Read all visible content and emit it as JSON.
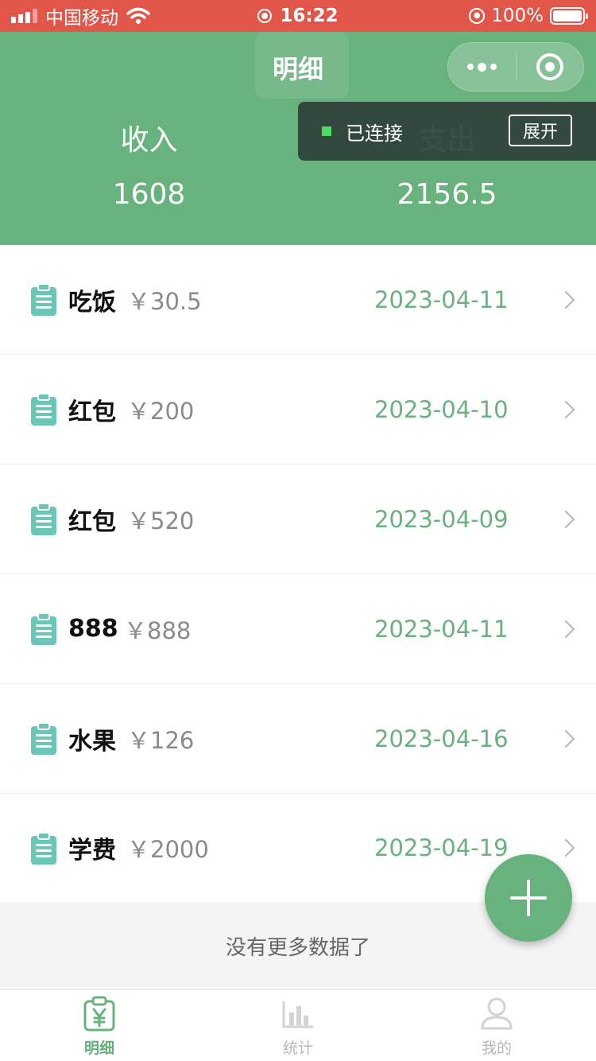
{
  "status_bar": {
    "carrier": "中国移动",
    "time": "16:22",
    "battery": "100%",
    "icons": [
      "signal-icon",
      "wifi-icon",
      "screen-record-icon",
      "rotation-lock-icon",
      "battery-icon"
    ]
  },
  "nav": {
    "title": "明细",
    "capsule_icons": [
      "more-icon",
      "close-miniprogram-icon"
    ]
  },
  "summary": {
    "income_label": "收入",
    "income_value": "1608",
    "expense_label": "支出",
    "expense_value": "2156.5"
  },
  "connection": {
    "status": "已连接",
    "expand_label": "展开",
    "dot_color": "#4cd964"
  },
  "records": [
    {
      "name": "吃饭",
      "amount": "￥30.5",
      "date": "2023-04-11"
    },
    {
      "name": "红包",
      "amount": "￥200",
      "date": "2023-04-10"
    },
    {
      "name": "红包",
      "amount": "￥520",
      "date": "2023-04-09"
    },
    {
      "name": "888",
      "amount": "￥888",
      "date": "2023-04-11"
    },
    {
      "name": "水果",
      "amount": "￥126",
      "date": "2023-04-16"
    },
    {
      "name": "学费",
      "amount": "￥2000",
      "date": "2023-04-19"
    }
  ],
  "list_footer": "没有更多数据了",
  "fab": {
    "icon": "plus-icon"
  },
  "tabs": [
    {
      "label": "明细",
      "icon": "yen-clipboard-icon",
      "active": true
    },
    {
      "label": "统计",
      "icon": "bar-chart-icon",
      "active": false
    },
    {
      "label": "我的",
      "icon": "person-icon",
      "active": false
    }
  ],
  "colors": {
    "status_bar": "#e2564a",
    "primary": "#68b27e",
    "icon_teal": "#6cc6b8",
    "muted": "#8a8a8a"
  }
}
